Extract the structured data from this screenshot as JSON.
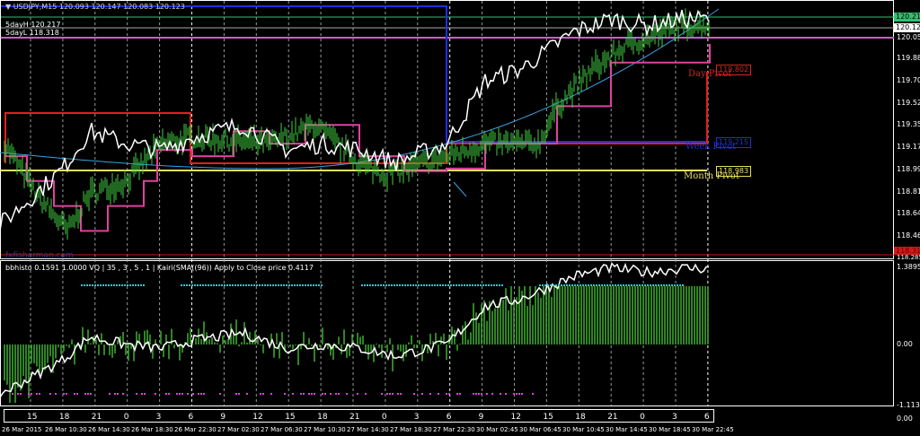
{
  "header": {
    "symbol": "USDJPY,M15",
    "ohlc": "120.093 120.147 120.083 120.123",
    "fiveday_high": "5dayH 120.217",
    "fiveday_low": "5dayL 118.318"
  },
  "watermark": "fxfisherman.com",
  "price_axis": {
    "labels": [
      "120.050",
      "119.880",
      "119.705",
      "119.525",
      "119.350",
      "119.170",
      "118.995",
      "118.815",
      "118.640",
      "118.460"
    ],
    "tag_high": "120.217",
    "tag_current": "120.123",
    "tag_low": "118.318",
    "bottom_partial": "118.285"
  },
  "pivots": {
    "day": {
      "label": "Day Pivot",
      "value": "119.802",
      "color": "#e02020"
    },
    "week": {
      "label": "Week Pivot",
      "value": "119.215",
      "color": "#2030e0"
    },
    "month": {
      "label": "Month Pivot",
      "value": "118.983",
      "color": "#e8e060"
    }
  },
  "sub": {
    "title": "bbhisto 0.1591 1.0000  VQ | 35 , 3 , 5 , 1 |   Kairi(SMA((96)) Apply to Close price 0.4117",
    "max": "1.3895",
    "zero": "0.00",
    "min": "-1.1138",
    "bottom": "0.00"
  },
  "hours": [
    "15",
    "18",
    "21",
    "0",
    "3",
    "6",
    "9",
    "12",
    "15",
    "18",
    "21",
    "0",
    "3",
    "6",
    "9",
    "12",
    "15",
    "18",
    "21",
    "0",
    "3",
    "6"
  ],
  "dates": [
    "26 Mar 2015",
    "26 Mar 10:30",
    "26 Mar 14:30",
    "26 Mar 18:30",
    "26 Mar 22:30",
    "27 Mar 02:30",
    "27 Mar 06:30",
    "27 Mar 10:30",
    "27 Mar 14:30",
    "27 Mar 18:30",
    "27 Mar 22:30",
    "30 Mar 02:45",
    "30 Mar 06:45",
    "30 Mar 10:45",
    "30 Mar 14:45",
    "30 Mar 18:45",
    "30 Mar 22:45"
  ],
  "chart_data": {
    "type": "line",
    "title": "USDJPY,M15",
    "white_line": [
      [
        0,
        118.55
      ],
      [
        40,
        118.8
      ],
      [
        70,
        119.0
      ],
      [
        100,
        119.3
      ],
      [
        140,
        119.2
      ],
      [
        180,
        119.15
      ],
      [
        214,
        119.25
      ],
      [
        270,
        119.35
      ],
      [
        320,
        119.15
      ],
      [
        360,
        119.2
      ],
      [
        400,
        119.15
      ],
      [
        440,
        119.05
      ],
      [
        497,
        119.2
      ],
      [
        540,
        119.7
      ],
      [
        580,
        119.8
      ],
      [
        610,
        119.95
      ],
      [
        640,
        120.1
      ],
      [
        680,
        120.2
      ],
      [
        720,
        120.15
      ],
      [
        760,
        120.2
      ],
      [
        790,
        120.2
      ]
    ],
    "green_price": [
      [
        5,
        119.2
      ],
      [
        40,
        118.8
      ],
      [
        75,
        118.5
      ],
      [
        100,
        118.8
      ],
      [
        140,
        118.9
      ],
      [
        180,
        119.2
      ],
      [
        214,
        119.25
      ],
      [
        300,
        119.2
      ],
      [
        350,
        119.35
      ],
      [
        400,
        119.05
      ],
      [
        430,
        118.95
      ],
      [
        497,
        119.1
      ],
      [
        540,
        119.2
      ],
      [
        600,
        119.2
      ],
      [
        620,
        119.5
      ],
      [
        660,
        119.8
      ],
      [
        700,
        120.0
      ],
      [
        760,
        120.15
      ],
      [
        790,
        120.15
      ]
    ],
    "magenta_step": [
      [
        5,
        119.1
      ],
      [
        30,
        118.9
      ],
      [
        60,
        118.7
      ],
      [
        90,
        118.5
      ],
      [
        120,
        118.7
      ],
      [
        160,
        118.9
      ],
      [
        175,
        119.15
      ],
      [
        214,
        119.1
      ],
      [
        260,
        119.3
      ],
      [
        300,
        119.2
      ],
      [
        340,
        119.35
      ],
      [
        400,
        119.1
      ],
      [
        450,
        118.98
      ],
      [
        497,
        119.0
      ],
      [
        540,
        119.2
      ],
      [
        620,
        119.5
      ],
      [
        680,
        119.85
      ],
      [
        790,
        120.0
      ]
    ],
    "ylim": [
      118.285,
      120.3
    ]
  }
}
